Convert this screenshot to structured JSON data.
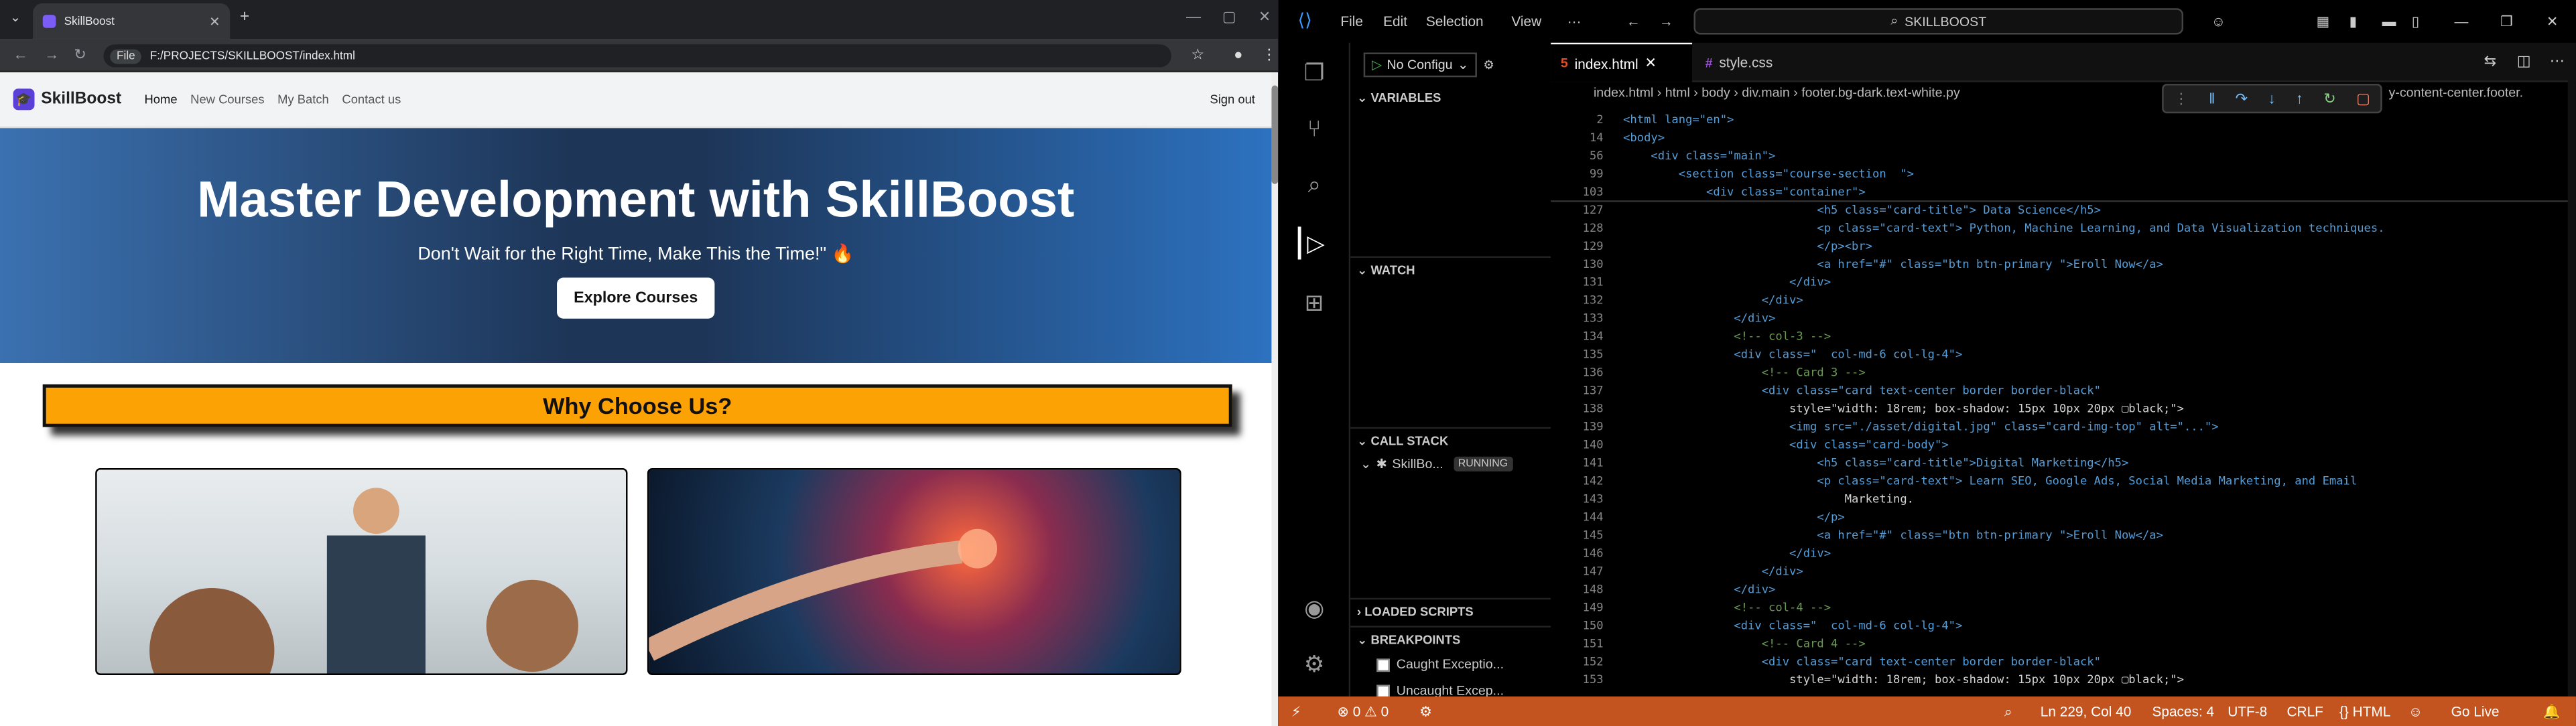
{
  "browser": {
    "tab_title": "SkillBoost",
    "url": "F:/PROJECTS/SKILLBOOST/index.html",
    "file_chip": "File"
  },
  "site": {
    "brand": "SkillBoost",
    "nav": [
      "Home",
      "New Courses",
      "My Batch",
      "Contact us"
    ],
    "signout": "Sign out",
    "hero_title": "Master Development with SkillBoost",
    "hero_sub": "Don't Wait for the Right Time, Make This the Time!\" 🔥",
    "hero_btn": "Explore Courses",
    "why": "Why Choose Us?"
  },
  "vscode": {
    "menu": [
      "File",
      "Edit",
      "Selection",
      "View",
      "···"
    ],
    "search": "SKILLBOOST",
    "run_config": "No Configu",
    "sections": {
      "variables": "VARIABLES",
      "watch": "WATCH",
      "callstack": "CALL STACK",
      "loaded": "LOADED SCRIPTS",
      "breakpoints": "BREAKPOINTS"
    },
    "callstack_item": "SkillBo...",
    "callstack_state": "RUNNING",
    "bp1": "Caught Exceptio...",
    "bp2": "Uncaught Excep...",
    "tab1": "index.html",
    "tab2": "style.css",
    "breadcrumb": "index.html  ›  html  ›  body  ›  div.main  ›  footer.bg-dark.text-white.py",
    "breadcrumb_tail": "y-content-center.footer.",
    "status": {
      "errors": "⊗ 0  ⚠ 0",
      "position": "Ln 229, Col 40",
      "spaces": "Spaces: 4",
      "enc": "UTF-8",
      "eol": "CRLF",
      "lang": "{} HTML",
      "golive": "Go Live"
    }
  },
  "code": [
    {
      "n": "2",
      "c": "<html lang=\"en\">"
    },
    {
      "n": "14",
      "c": "<body>"
    },
    {
      "n": "56",
      "c": "    <div class=\"main\">"
    },
    {
      "n": "99",
      "c": "        <section class=\"course-section  \">"
    },
    {
      "n": "103",
      "c": "            <div class=\"container\">"
    },
    {
      "n": "127",
      "c": "                            <h5 class=\"card-title\"> Data Science</h5>"
    },
    {
      "n": "128",
      "c": "                            <p class=\"card-text\"> Python, Machine Learning, and Data Visualization techniques."
    },
    {
      "n": "129",
      "c": "                            </p><br>"
    },
    {
      "n": "130",
      "c": "                            <a href=\"#\" class=\"btn btn-primary \">Eroll Now</a>"
    },
    {
      "n": "131",
      "c": "                        </div>"
    },
    {
      "n": "132",
      "c": "                    </div>"
    },
    {
      "n": "133",
      "c": "                </div>"
    },
    {
      "n": "134",
      "c": "                <!-- col-3 -->"
    },
    {
      "n": "135",
      "c": "                <div class=\"  col-md-6 col-lg-4\">"
    },
    {
      "n": "136",
      "c": "                    <!-- Card 3 -->"
    },
    {
      "n": "137",
      "c": "                    <div class=\"card text-center border border-black\""
    },
    {
      "n": "138",
      "c": "                        style=\"width: 18rem; box-shadow: 15px 10px 20px ▢black;\">"
    },
    {
      "n": "139",
      "c": "                        <img src=\"./asset/digital.jpg\" class=\"card-img-top\" alt=\"...\">"
    },
    {
      "n": "140",
      "c": "                        <div class=\"card-body\">"
    },
    {
      "n": "141",
      "c": "                            <h5 class=\"card-title\">Digital Marketing</h5>"
    },
    {
      "n": "142",
      "c": "                            <p class=\"card-text\"> Learn SEO, Google Ads, Social Media Marketing, and Email"
    },
    {
      "n": "143",
      "c": "                                Marketing."
    },
    {
      "n": "144",
      "c": "                            </p>"
    },
    {
      "n": "145",
      "c": "                            <a href=\"#\" class=\"btn btn-primary \">Eroll Now</a>"
    },
    {
      "n": "146",
      "c": "                        </div>"
    },
    {
      "n": "147",
      "c": "                    </div>"
    },
    {
      "n": "148",
      "c": "                </div>"
    },
    {
      "n": "149",
      "c": "                <!-- col-4 -->"
    },
    {
      "n": "150",
      "c": "                <div class=\"  col-md-6 col-lg-4\">"
    },
    {
      "n": "151",
      "c": "                    <!-- Card 4 -->"
    },
    {
      "n": "152",
      "c": "                    <div class=\"card text-center border border-black\""
    },
    {
      "n": "153",
      "c": "                        style=\"width: 18rem; box-shadow: 15px 10px 20px ▢black;\">"
    }
  ]
}
